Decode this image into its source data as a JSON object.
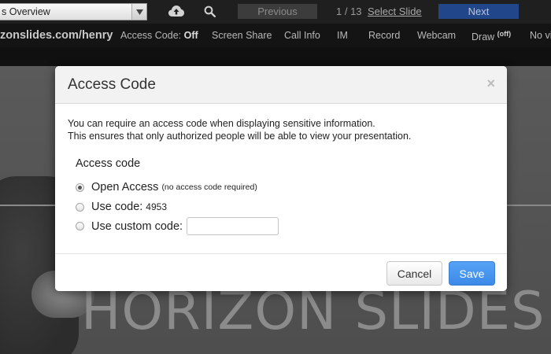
{
  "toolbar": {
    "deck_name": "s Overview",
    "previous_label": "Previous",
    "slide_counter": "1 / 13",
    "select_slide_label": "Select Slide",
    "next_label": "Next"
  },
  "menubar": {
    "url": "zonslides.com/henry",
    "access_code_label": "Access Code: ",
    "access_code_value": "Off",
    "screen_share": "Screen Share",
    "call_info": "Call Info",
    "im": "IM",
    "record": "Record",
    "webcam": "Webcam",
    "draw": "Draw",
    "draw_state": "(off)",
    "no_video": "No vi"
  },
  "slide": {
    "brand_text": "HORIZON SLIDES"
  },
  "modal": {
    "title": "Access Code",
    "close_symbol": "×",
    "description_line1": "You can require an access code when displaying sensitive information.",
    "description_line2": "This ensures that only authorized people will be able to view your presentation.",
    "section_title": "Access code",
    "options": [
      {
        "label": "Open Access",
        "note": "(no access code required)",
        "checked": true
      },
      {
        "label": "Use code:",
        "code": "4953",
        "checked": false
      },
      {
        "label": "Use custom code:",
        "checked": false
      }
    ],
    "custom_code_value": "",
    "cancel_label": "Cancel",
    "save_label": "Save"
  },
  "colors": {
    "save_button": "#3c8ae8",
    "next_button": "#21468a",
    "toolbar_bg": "#1f1f1f"
  },
  "icons": {
    "cloud": "cloud-upload-icon",
    "search": "search-icon",
    "dropdown": "chevron-down-icon",
    "close": "close-icon"
  }
}
